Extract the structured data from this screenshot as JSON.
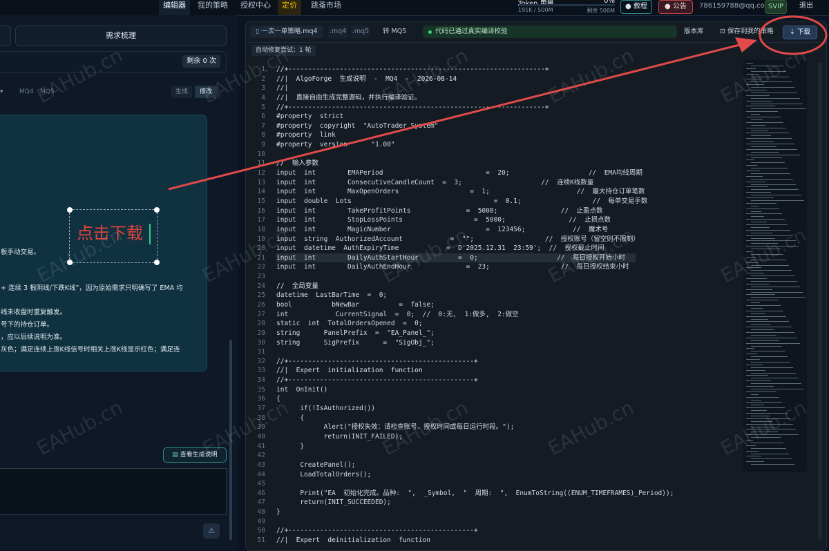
{
  "topbar": {
    "nav": [
      "编辑器",
      "我的策略",
      "授权中心",
      "定价",
      "跳蚤市场"
    ],
    "token_label": "Token 用量",
    "token_pct": "0%",
    "token_used": "191K / 500M",
    "token_remaining": "剩余 500M",
    "token_fraction": 0.0004,
    "tutorial": "● 教程",
    "notice": "● 公告",
    "email": "786159788@qq.com",
    "vip": "SVIP",
    "logout": "退出"
  },
  "left": {
    "req_tab": "需求梳理",
    "remaining": "剩余 0 次",
    "mq4": "MQ4",
    "mq5": "MQ5",
    "gen": "生成",
    "edit": "修改",
    "req_lines": [
      "板手动交易。",
      "+ 连续 3 根阴线/下跌K线”，因为原始需求只明确写了 EMA 均",
      "线未收盘时重复触发。",
      "号下的持仓订单。",
      "，应以后续说明为准。",
      "灰色；满足连续上涨K线信号时相关上涨K线显示红色；满足连"
    ],
    "annotation": "点击下载",
    "view_explain": "查看生成说明",
    "send_icon": "warning-icon"
  },
  "editor": {
    "file_tab": "一次一单策略.mq4",
    "mq4_tab": ".mq4",
    "mq5_tab": ".mq5",
    "to_mq5": "转 MQ5",
    "compile_ok": "代码已通过真实编译校验",
    "repo": "版本库",
    "save": "保存到我的策略",
    "download": "下载",
    "autofix": "自动修复尝试：1 轮",
    "highlight_line": 21,
    "lines": [
      {
        "n": 1,
        "t": "//+-----------------------------------------------------------------+"
      },
      {
        "n": 2,
        "t": "//|  AlgoForge  生成说明  -  MQ4  -  2026-08-14"
      },
      {
        "n": 3,
        "t": "//|"
      },
      {
        "n": 4,
        "t": "//|  直接自由生成完整源码，并执行编译验证。"
      },
      {
        "n": 5,
        "t": "//+-----------------------------------------------------------------+"
      },
      {
        "n": 6,
        "t": "#property  strict"
      },
      {
        "n": 7,
        "t": "#property  copyright  \"AutoTrader System\""
      },
      {
        "n": 8,
        "t": "#property  link"
      },
      {
        "n": 9,
        "t": "#property  version      \"1.00\""
      },
      {
        "n": 10,
        "t": ""
      },
      {
        "n": 11,
        "t": "//  输入参数"
      },
      {
        "n": 12,
        "t": "input  int        EMAPeriod                          =  20;                    //  EMA均线周期"
      },
      {
        "n": 13,
        "t": "input  int        ConsecutiveCandleCount  =  3;                    //  连续K线数量"
      },
      {
        "n": 14,
        "t": "input  int        MaxOpenOrders                  =  1;                      //  最大持仓订单笔数"
      },
      {
        "n": 15,
        "t": "input  double  Lots                                    =  0.1;                  //  每单交易手数"
      },
      {
        "n": 16,
        "t": "input  int        TakeProfitPoints              =  5000;                //  止盈点数"
      },
      {
        "n": 17,
        "t": "input  int        StopLossPoints                  =  5000;                //  止损点数"
      },
      {
        "n": 18,
        "t": "input  int        MagicNumber                        =  123456;            //  魔术号"
      },
      {
        "n": 19,
        "t": "input  string  AuthorizedAccount            =  \"\";                  //  授权账号（留空则不限制）"
      },
      {
        "n": 20,
        "t": "input  datetime  AuthExpiryTime            =  D'2025.12.31  23:59';  //  授权截止时间"
      },
      {
        "n": 21,
        "t": "input  int        DailyAuthStartHour          =  0;                    //  每日授权开始小时"
      },
      {
        "n": 22,
        "t": "input  int        DailyAuthEndHour              =  23;                  //  每日授权结束小时"
      },
      {
        "n": 23,
        "t": ""
      },
      {
        "n": 24,
        "t": "//  全局变量"
      },
      {
        "n": 25,
        "t": "datetime  LastBarTime  =  0;"
      },
      {
        "n": 26,
        "t": "bool          bNewBar          =  false;"
      },
      {
        "n": 27,
        "t": "int            CurrentSignal  =  0;  //  0:无,  1:做多,  2:做空"
      },
      {
        "n": 28,
        "t": "static  int  TotalOrdersOpened  =  0;"
      },
      {
        "n": 29,
        "t": "string      PanelPrefix  =  \"EA_Panel_\";"
      },
      {
        "n": 30,
        "t": "string      SigPrefix      =  \"SigObj_\";"
      },
      {
        "n": 31,
        "t": ""
      },
      {
        "n": 32,
        "t": "//+-----------------------------------------------+"
      },
      {
        "n": 33,
        "t": "//|  Expert  initialization  function"
      },
      {
        "n": 34,
        "t": "//+-----------------------------------------------+"
      },
      {
        "n": 35,
        "t": "int  OnInit()"
      },
      {
        "n": 36,
        "t": "{"
      },
      {
        "n": 37,
        "t": "      if(!IsAuthorized())"
      },
      {
        "n": 38,
        "t": "      {"
      },
      {
        "n": 39,
        "t": "            Alert(\"授权失效：请检查账号、授权时间或每日运行时段。\");"
      },
      {
        "n": 40,
        "t": "            return(INIT_FAILED);"
      },
      {
        "n": 41,
        "t": "      }"
      },
      {
        "n": 42,
        "t": ""
      },
      {
        "n": 43,
        "t": "      CreatePanel();"
      },
      {
        "n": 44,
        "t": "      LoadTotalOrders();"
      },
      {
        "n": 45,
        "t": ""
      },
      {
        "n": 46,
        "t": "      Print(\"EA  初始化完成。品种:  \",  _Symbol,  \"  周期:  \",  EnumToString((ENUM_TIMEFRAMES)_Period));"
      },
      {
        "n": 47,
        "t": "      return(INIT_SUCCEEDED);"
      },
      {
        "n": 48,
        "t": "}"
      },
      {
        "n": 49,
        "t": ""
      },
      {
        "n": 50,
        "t": "//+-----------------------------------------------+"
      },
      {
        "n": 51,
        "t": "//|  Expert  deinitialization  function"
      }
    ]
  },
  "watermark": "EAHub.cn",
  "colors": {
    "accent": "#2fb7a3",
    "pricing": "#f0b90b",
    "annotation": "#e1443d",
    "success": "#39d479"
  }
}
